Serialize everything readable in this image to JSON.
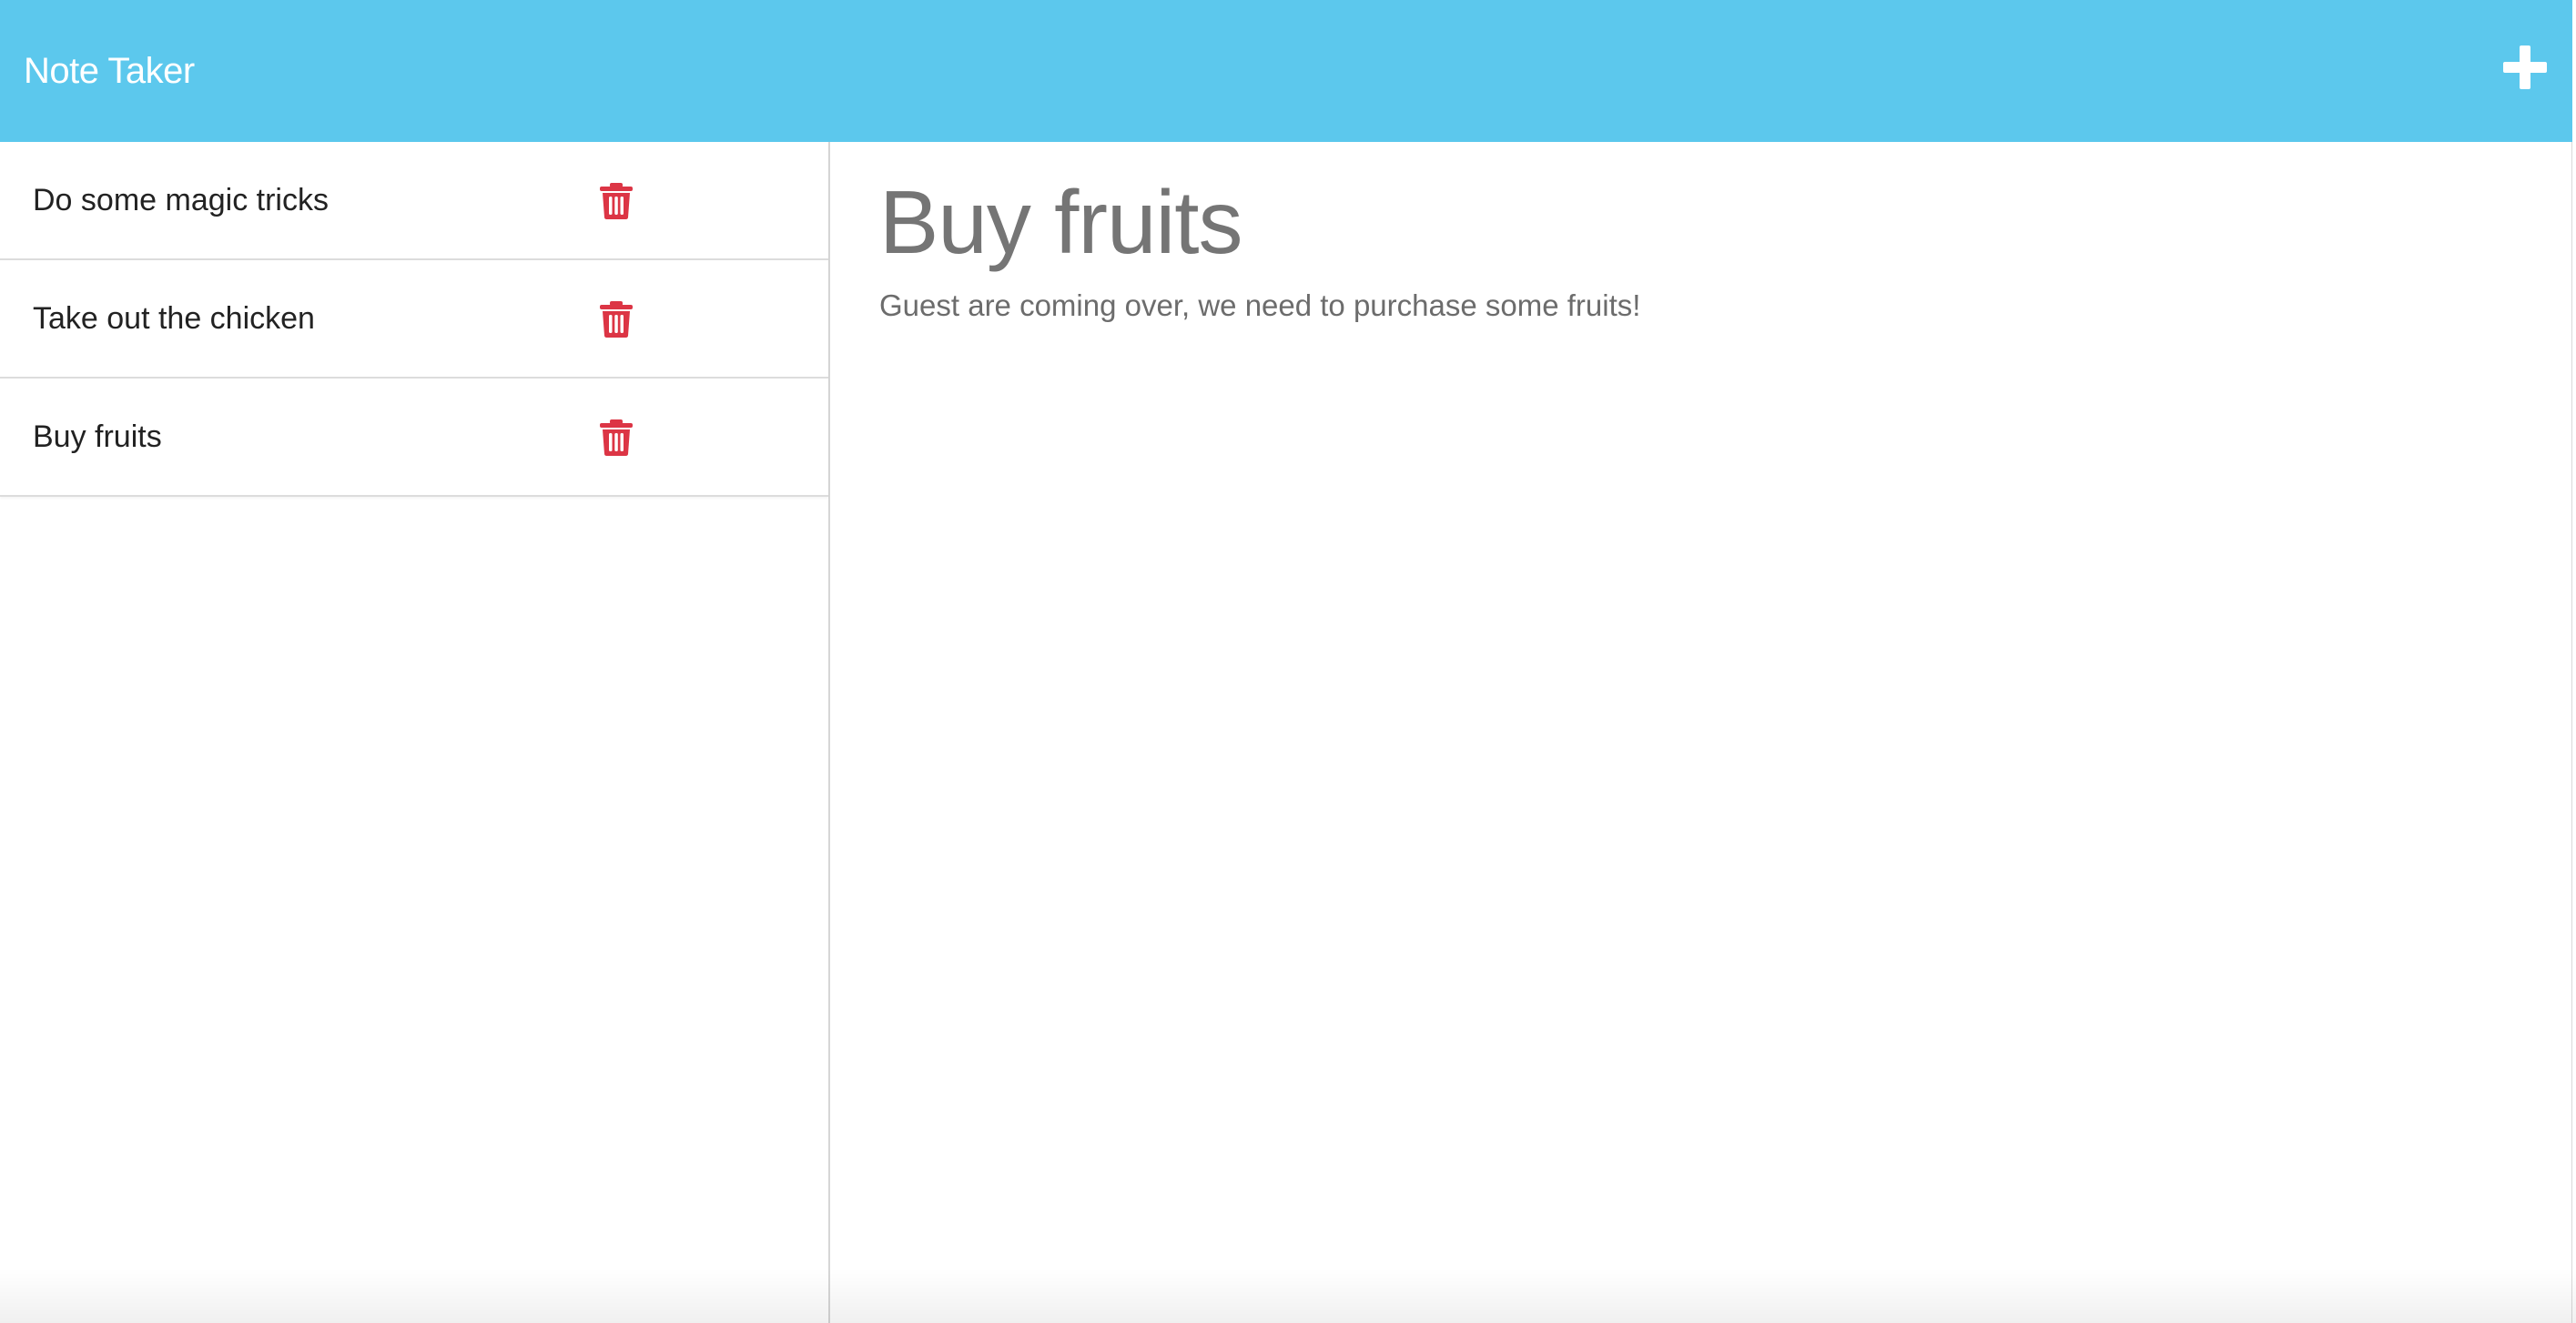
{
  "app": {
    "title": "Note Taker",
    "new_note_icon": "plus-icon",
    "accent_color": "#5cc8ed"
  },
  "sidebar": {
    "items": [
      {
        "label": "Do some magic tricks",
        "delete_icon": "trash-icon"
      },
      {
        "label": "Take out the chicken",
        "delete_icon": "trash-icon"
      },
      {
        "label": "Buy fruits",
        "delete_icon": "trash-icon"
      }
    ],
    "delete_color": "#dc3545"
  },
  "editor": {
    "title": "Buy fruits",
    "body": "Guest are coming over, we need to purchase some fruits!"
  }
}
